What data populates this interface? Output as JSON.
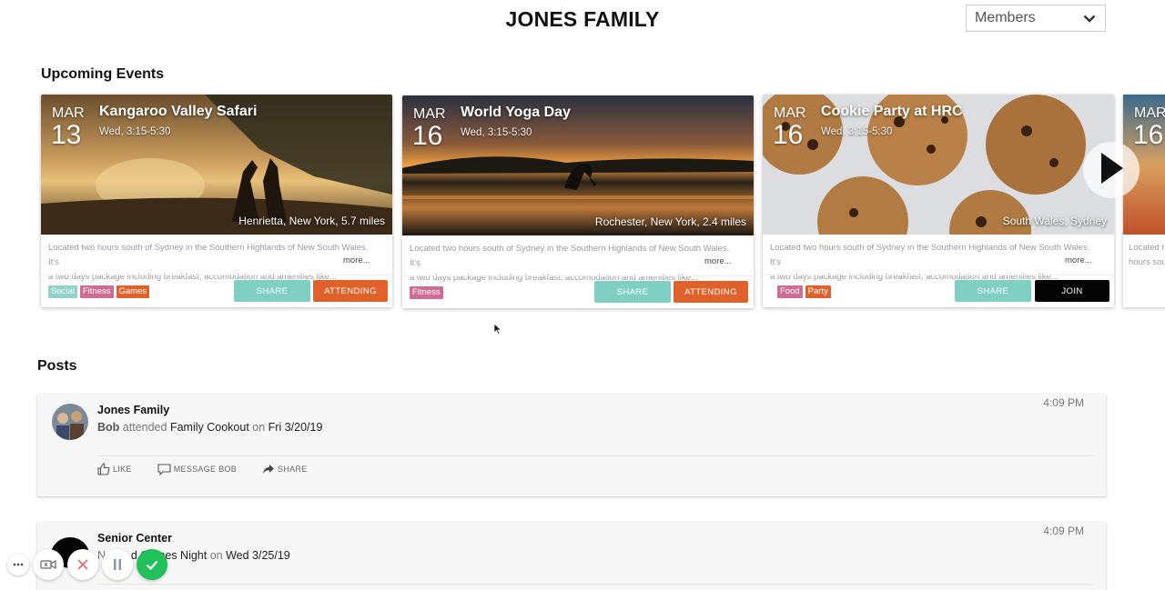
{
  "header": {
    "title": "JONES FAMILY",
    "members_select": {
      "value": "Members"
    }
  },
  "sections": {
    "upcoming_events": "Upcoming Events",
    "posts": "Posts"
  },
  "events": [
    {
      "month": "MAR",
      "day": "13",
      "title": "Kangaroo Valley Safari",
      "time": "Wed, 3:15-5:30",
      "location": "Henrietta, New York, 5.7 miles",
      "desc_line1": "Located two hours south of Sydney in the Southern Highlands of New South Wales. It's",
      "desc_line2": "a two days package including breakfast, accomodation and amenities like...",
      "more": "more...",
      "tags": [
        "Social",
        "Fitness",
        "Games"
      ],
      "share_label": "SHARE",
      "action_label": "ATTENDING"
    },
    {
      "month": "MAR",
      "day": "16",
      "title": "World Yoga Day",
      "time": "Wed, 3:15-5:30",
      "location": "Rochester, New York, 2.4 miles",
      "desc_line1": "Located two hours south of Sydney in the Southern Highlands of New South Wales. It's",
      "desc_line2": "a two days package including breakfast, accomodation and amenities like...",
      "more": "more...",
      "tags": [
        "Fitness"
      ],
      "share_label": "SHARE",
      "action_label": "ATTENDING"
    },
    {
      "month": "MAR",
      "day": "16",
      "title": "Cookie Party at HRC",
      "time": "Wed, 3:15-5:30",
      "location": "South Wales, Sydney",
      "desc_line1": "Located two hours south of Sydney in the Southern Highlands of New South Wales. It's",
      "desc_line2": "a two days package including breakfast, accomodation and amenities like...",
      "more": "more...",
      "tags": [
        "Food",
        "Party"
      ],
      "share_label": "SHARE",
      "action_label": "JOIN"
    },
    {
      "month": "MAR",
      "day": "16",
      "desc_line1": "Located t",
      "desc_line2": "hours sou"
    }
  ],
  "posts": [
    {
      "author": "Jones Family",
      "actor": "Bob",
      "verb": "attended",
      "event": "Family Cookout",
      "on": "on",
      "date": "Fri 3/20/19",
      "time": "4:09 PM",
      "actions": {
        "like": "LIKE",
        "message": "MESSAGE BOB",
        "share": "SHARE"
      }
    },
    {
      "author": "Senior Center",
      "actor": "Ne",
      "verb": "ent",
      "event": "d Games Night",
      "on": "on",
      "date": "Wed 3/25/19",
      "time": "4:09 PM"
    }
  ],
  "icons": {
    "dropdown": "chevron-down-icon",
    "carousel_next": "play-right-icon",
    "like": "thumbs-up-icon",
    "message": "comment-icon",
    "share": "share-arrow-icon",
    "recorder": [
      "more-dots-icon",
      "camera-off-icon",
      "close-icon",
      "pause-icon",
      "check-icon"
    ]
  },
  "colors": {
    "tag_social": "#8fd3c8",
    "tag_fitness": "#d06b96",
    "tag_games": "#e0622a",
    "share_button": "#7fcfc3",
    "attending_button": "#e0622a",
    "join_button": "#050505",
    "recorder_confirm": "#22c05a"
  }
}
